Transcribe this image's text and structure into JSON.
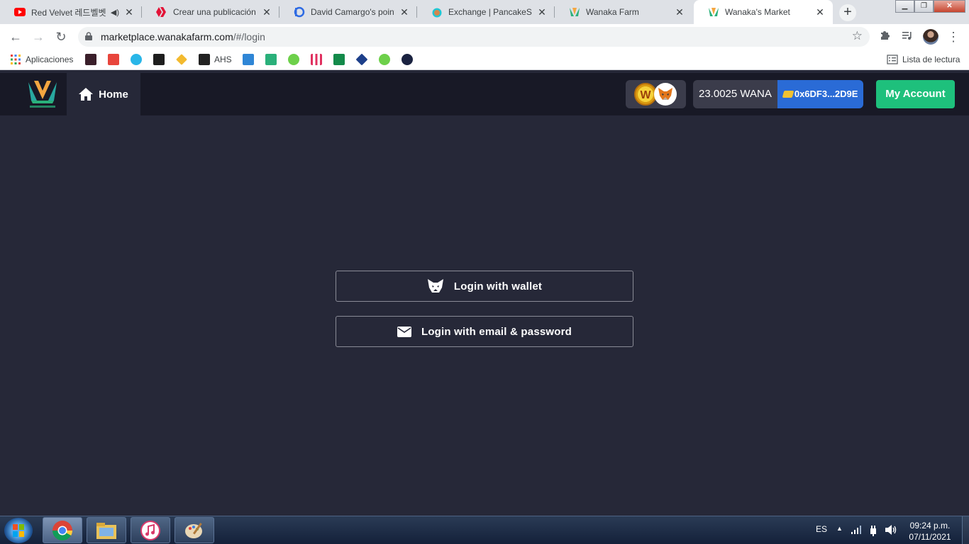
{
  "browser": {
    "tabs": [
      {
        "title": "Red Velvet 레드벨벳",
        "icon": "youtube-icon",
        "active": false
      },
      {
        "title": "Crear una publicación —",
        "icon": "hive-icon",
        "active": false
      },
      {
        "title": "David Camargo's points",
        "icon": "peakd-icon",
        "active": false
      },
      {
        "title": "Exchange | PancakeSwap",
        "icon": "pancakeswap-icon",
        "active": false
      },
      {
        "title": "Wanaka Farm",
        "icon": "wanaka-icon",
        "active": false
      },
      {
        "title": "Wanaka's Market",
        "icon": "wanaka-icon",
        "active": true
      }
    ],
    "new_tab_label": "+",
    "url_host": "marketplace.wanakafarm.com",
    "url_path": "/#/login",
    "bookmarks": {
      "apps_label": "Aplicaciones",
      "ahs_label": "AHS",
      "reading_list_label": "Lista de lectura"
    }
  },
  "navbar": {
    "home_label": "Home",
    "balance": "23.0025 WANA",
    "wallet_address": "0x6DF3...2D9E",
    "account_button": "My Account"
  },
  "login": {
    "wallet_button": "Login with wallet",
    "email_button": "Login with email & password"
  },
  "taskbar": {
    "language": "ES",
    "time": "09:24 p.m.",
    "date": "07/11/2021"
  },
  "colors": {
    "page_background": "#262838",
    "navbar_background": "#181926",
    "account_button": "#1ec07c",
    "address_pill": "#2a6bd6"
  }
}
